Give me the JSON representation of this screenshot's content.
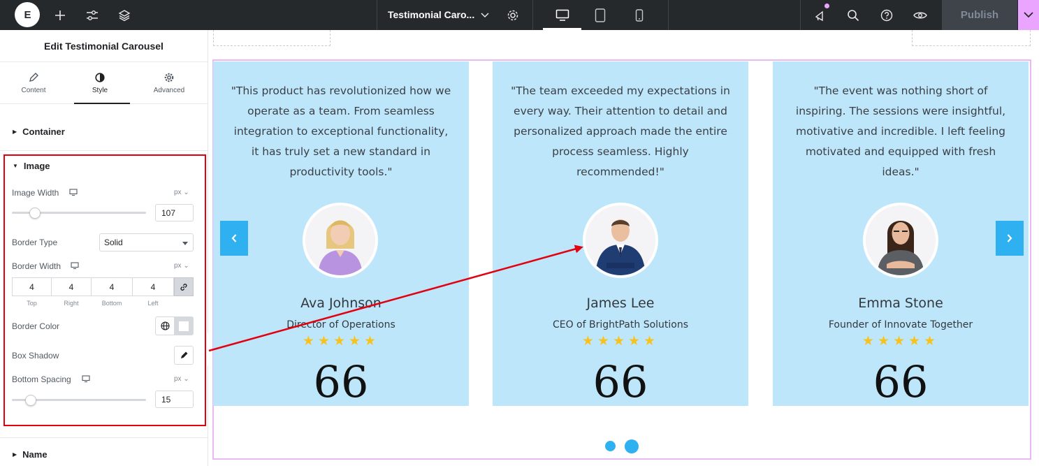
{
  "topbar": {
    "logo_text": "E",
    "widget_title": "Testimonial Caro...",
    "publish_label": "Publish",
    "icons": [
      "elementor-logo-icon",
      "add-icon",
      "settings-sliders-icon",
      "layers-icon",
      "chevron-down-icon",
      "gear-icon",
      "desktop-icon",
      "tablet-icon",
      "mobile-icon",
      "notifications-icon",
      "search-icon",
      "help-icon",
      "preview-eye-icon",
      "chevron-down-icon"
    ],
    "accent": "#e9a5ff"
  },
  "panel": {
    "title": "Edit Testimonial Carousel",
    "tabs": [
      {
        "label": "Content",
        "icon": "pencil-icon"
      },
      {
        "label": "Style",
        "icon": "contrast-icon",
        "active": true
      },
      {
        "label": "Advanced",
        "icon": "gear-icon"
      }
    ],
    "section_container": "Container",
    "section_image": "Image",
    "section_name": "Name",
    "image_width": {
      "label": "Image Width",
      "unit": "px",
      "value": "107",
      "level": 0.1
    },
    "border_type": {
      "label": "Border Type",
      "value": "Solid"
    },
    "border_width": {
      "label": "Border Width",
      "unit": "px",
      "top": "4",
      "right": "4",
      "bottom": "4",
      "left": "4",
      "labels": {
        "top": "Top",
        "right": "Right",
        "bottom": "Bottom",
        "left": "Left"
      }
    },
    "border_color": {
      "label": "Border Color",
      "value": "#ffffff"
    },
    "box_shadow": {
      "label": "Box Shadow"
    },
    "bottom_spacing": {
      "label": "Bottom Spacing",
      "unit": "px",
      "value": "15",
      "level": 0.08
    },
    "highlight_color": "#e3000f"
  },
  "carousel": {
    "card_color": "#bee6fb",
    "accent": "#2fb0f0",
    "star_color": "#f8c21c",
    "cards": [
      {
        "quote": "\"This product has revolutionized how we operate as a team. From seamless integration to exceptional functionality, it has truly set a new standard in productivity tools.\"",
        "name": "Ava Johnson",
        "role": "Director of Operations",
        "stars": "★★★★★",
        "quote_mark": "66"
      },
      {
        "quote": "\"The team exceeded my expectations in every way. Their attention to detail and personalized approach made the entire process seamless. Highly recommended!\"",
        "name": "James Lee",
        "role": "CEO of BrightPath Solutions",
        "stars": "★★★★★",
        "quote_mark": "66"
      },
      {
        "quote": "\"The event was nothing short of inspiring. The sessions were insightful, motivative and incredible. I left feeling motivated and equipped with fresh ideas.\"",
        "name": "Emma Stone",
        "role": "Founder of Innovate Together",
        "stars": "★★★★★",
        "quote_mark": "66"
      }
    ],
    "pagination_count": 2,
    "active_page": 2
  }
}
